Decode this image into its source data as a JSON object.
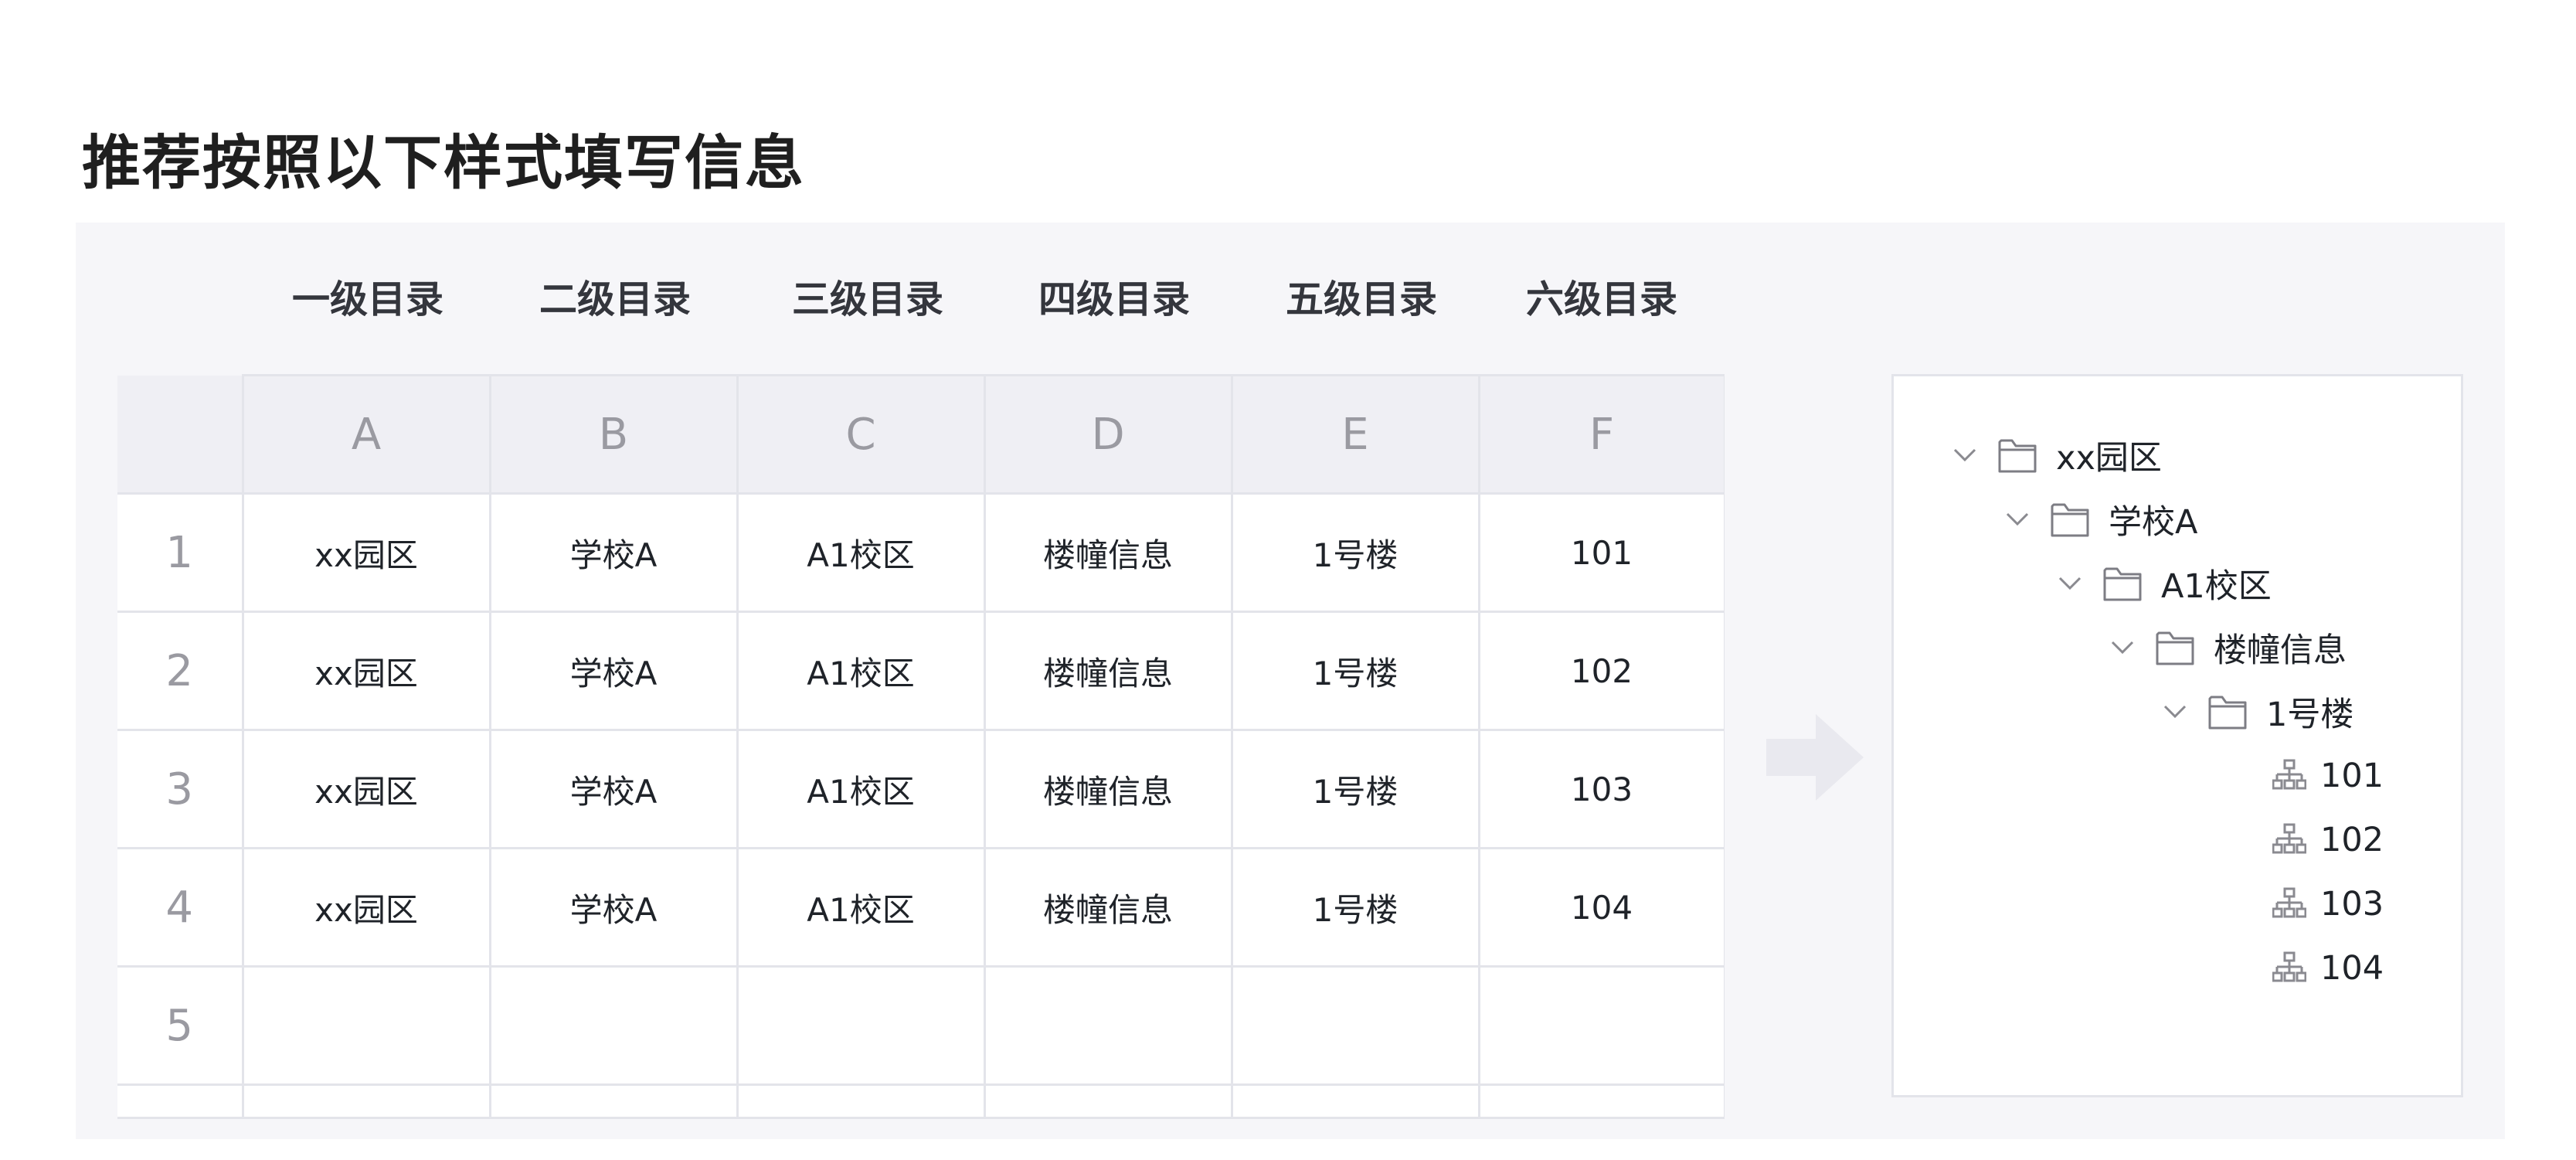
{
  "page": {
    "title": "推荐按照以下样式填写信息"
  },
  "levels": [
    "一级目录",
    "二级目录",
    "三级目录",
    "四级目录",
    "五级目录",
    "六级目录"
  ],
  "sheet": {
    "columns": [
      "A",
      "B",
      "C",
      "D",
      "E",
      "F"
    ],
    "rows": [
      {
        "num": "1",
        "cells": [
          "xx园区",
          "学校A",
          "A1校区",
          "楼幢信息",
          "1号楼",
          "101"
        ]
      },
      {
        "num": "2",
        "cells": [
          "xx园区",
          "学校A",
          "A1校区",
          "楼幢信息",
          "1号楼",
          "102"
        ]
      },
      {
        "num": "3",
        "cells": [
          "xx园区",
          "学校A",
          "A1校区",
          "楼幢信息",
          "1号楼",
          "103"
        ]
      },
      {
        "num": "4",
        "cells": [
          "xx园区",
          "学校A",
          "A1校区",
          "楼幢信息",
          "1号楼",
          "104"
        ]
      },
      {
        "num": "5",
        "cells": [
          "",
          "",
          "",
          "",
          "",
          ""
        ]
      }
    ]
  },
  "tree": {
    "nodes": [
      {
        "label": "xx园区",
        "type": "folder"
      },
      {
        "label": "学校A",
        "type": "folder"
      },
      {
        "label": "A1校区",
        "type": "folder"
      },
      {
        "label": "楼幢信息",
        "type": "folder"
      },
      {
        "label": "1号楼",
        "type": "folder"
      },
      {
        "label": "101",
        "type": "leaf"
      },
      {
        "label": "102",
        "type": "leaf"
      },
      {
        "label": "103",
        "type": "leaf"
      },
      {
        "label": "104",
        "type": "leaf"
      }
    ]
  },
  "colors": {
    "panel_bg": "#f6f6f9",
    "grid_line": "#e3e4ea",
    "header_bg": "#efeff4",
    "muted_text": "#9a9aa1",
    "arrow": "#e9e9ef"
  },
  "icons": {
    "expand": "chevron-down-icon",
    "folder": "folder-icon",
    "leaf": "org-chart-icon",
    "arrow": "arrow-right-icon"
  }
}
